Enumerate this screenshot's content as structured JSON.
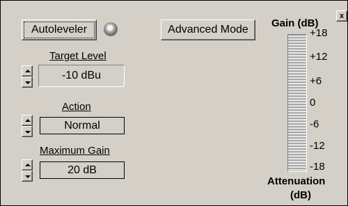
{
  "buttons": {
    "autoleveler": "Autoleveler",
    "advanced_mode": "Advanced Mode",
    "close_glyph": "x"
  },
  "target_level": {
    "label": "Target Level",
    "value": "-10 dBu"
  },
  "action": {
    "label": "Action",
    "value": "Normal"
  },
  "maximum_gain": {
    "label": "Maximum Gain",
    "value": "20 dB"
  },
  "meter": {
    "title": "Gain (dB)",
    "scale": [
      "+18",
      "+12",
      "+6",
      "0",
      "-6",
      "-12",
      "-18"
    ],
    "bottom_label_line1": "Attenuation",
    "bottom_label_line2": "(dB)"
  },
  "icons": {
    "indicator": "status-led-icon",
    "spin_up": "triangle-up-icon",
    "spin_down": "triangle-down-icon",
    "close": "close-icon"
  }
}
